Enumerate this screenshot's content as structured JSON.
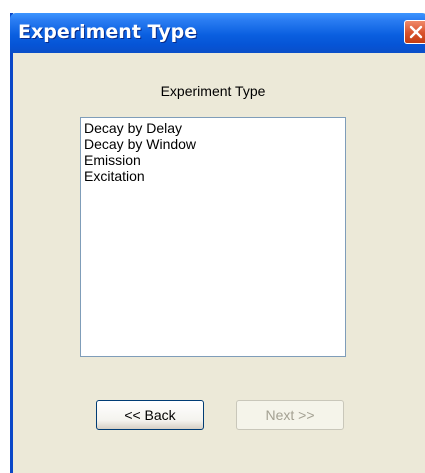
{
  "window": {
    "title": "Experiment Type",
    "close_icon": "close-icon"
  },
  "group_label": "Experiment Type",
  "experiment_types": [
    "Decay by Delay",
    "Decay by Window",
    "Emission",
    "Excitation"
  ],
  "buttons": {
    "back_label": "<< Back",
    "next_label": "Next >>",
    "next_enabled": false
  },
  "colors": {
    "titlebar": "#0a5fe0",
    "window_bg": "#ece9d8",
    "close_button": "#d8522c"
  }
}
